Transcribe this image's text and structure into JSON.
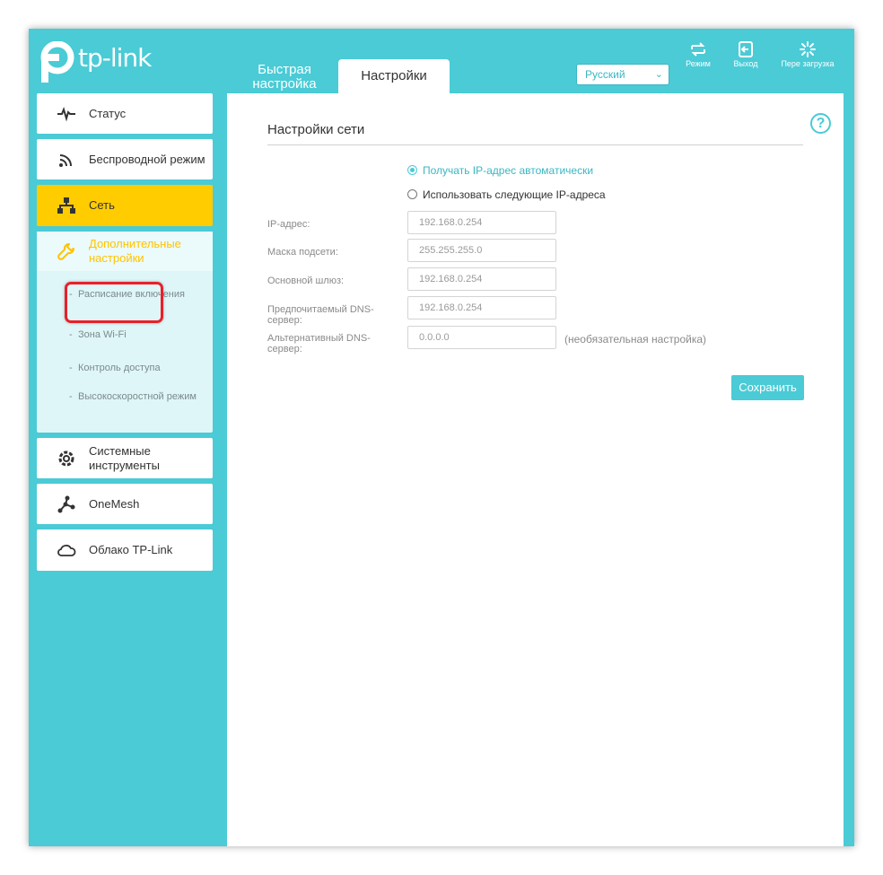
{
  "header": {
    "logo_text": "tp-link",
    "tabs": [
      {
        "label": "Быстрая настройка"
      },
      {
        "label": "Настройки"
      }
    ],
    "language": {
      "selected": "Русский"
    },
    "tools": {
      "mode": "Режим",
      "exit": "Выход",
      "reboot": "Пере загрузка"
    }
  },
  "sidebar": {
    "items": [
      {
        "label": "Статус",
        "icon": "status-pulse-icon"
      },
      {
        "label": "Беспроводной режим",
        "icon": "wifi-icon"
      },
      {
        "label": "Сеть",
        "icon": "network-icon"
      },
      {
        "label": "Дополнительные настройки",
        "icon": "wrench-icon"
      },
      {
        "label": "Системные инструменты",
        "icon": "gear-icon"
      },
      {
        "label": "OneMesh",
        "icon": "onemesh-icon"
      },
      {
        "label": "Облако TP-Link",
        "icon": "cloud-icon"
      }
    ],
    "advanced_sub": [
      {
        "label": "Расписание включения"
      },
      {
        "label": "Зона Wi-Fi"
      },
      {
        "label": "Контроль доступа"
      },
      {
        "label": "Высокоскоростной режим"
      }
    ],
    "dash": "-"
  },
  "main": {
    "title": "Настройки сети",
    "help": "?",
    "radio_auto": "Получать IP-адрес автоматически",
    "radio_manual": "Использовать следующие IP-адреса",
    "fields": {
      "ip": {
        "label": "IP-адрес:",
        "value": "192.168.0.254"
      },
      "mask": {
        "label": "Маска подсети:",
        "value": "255.255.255.0"
      },
      "gateway": {
        "label": "Основной шлюз:",
        "value": "192.168.0.254"
      },
      "dns1": {
        "label": "Предпочитаемый DNS-сервер:",
        "value": "192.168.0.254"
      },
      "dns2": {
        "label": "Альтернативный DNS-сервер:",
        "value": "0.0.0.0"
      }
    },
    "optional_note": "(необязательная настройка)",
    "save_label": "Сохранить"
  },
  "colors": {
    "accent": "#4acbd6",
    "active_nav": "#ffcc00",
    "highlight": "#e8202a"
  }
}
